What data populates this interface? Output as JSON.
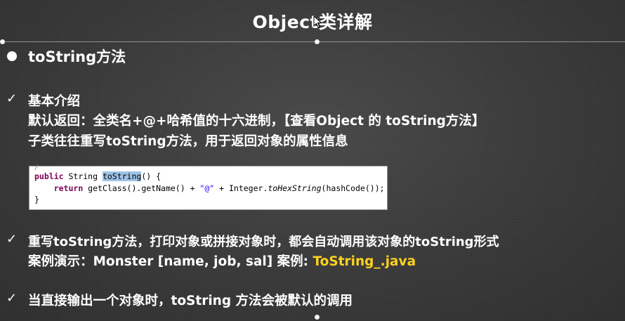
{
  "slide": {
    "title": "Object类详解",
    "heading": "toString方法",
    "section1": {
      "label": "基本介绍",
      "line1": "默认返回：全类名+@+哈希值的十六进制，【查看Object 的 toString方法】",
      "line2": "子类往往重写toString方法，用于返回对象的属性信息"
    },
    "code": {
      "line1_kw1": "public",
      "line1_type": " String ",
      "line1_method": "toString",
      "line1_rest": "() {",
      "line2_kw": "return",
      "line2_a": " getClass().getName() + ",
      "line2_str": "\"@\"",
      "line2_b": " + Integer.",
      "line2_it": "toHexString",
      "line2_c": "(hashCode());",
      "line3": "}"
    },
    "section2": {
      "line1": "重写toString方法，打印对象或拼接对象时，都会自动调用该对象的toString形式",
      "line2_prefix": "案例演示：Monster [name, job, sal]  案例: ",
      "line2_file": "ToString_.java"
    },
    "section3": {
      "line1": "当直接输出一个对象时，toString 方法会被默认的调用"
    }
  },
  "colors": {
    "background": "#3c3c3c",
    "text": "#ffffff",
    "accent_yellow": "#ffd21e",
    "code_keyword": "#7f0055",
    "code_string": "#2a00ff",
    "code_selection": "#9fc3e7"
  }
}
